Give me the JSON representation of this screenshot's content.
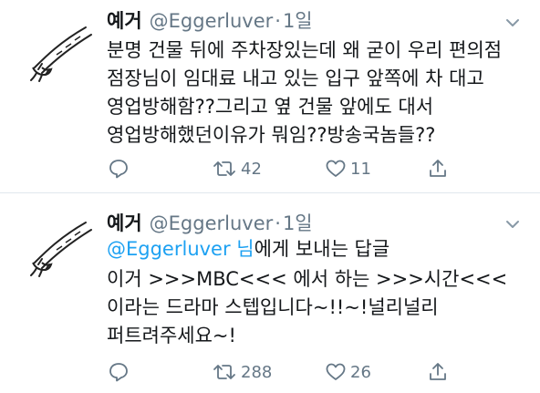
{
  "tweets": [
    {
      "name": "예거",
      "handle": "@Eggerluver",
      "separator": "·",
      "time": "1일",
      "reply_to": null,
      "lines": [
        "분명 건물 뒤에 주차장있는데 왜 굳이 우리 편의점",
        "점장님이 임대료 내고 있는 입구 앞쪽에 차 대고",
        "영업방해함??그리고 옆 건물 앞에도 대서",
        "영업방해했던이유가 뭐임??방송국놈들??"
      ],
      "retweets": "42",
      "likes": "11"
    },
    {
      "name": "예거",
      "handle": "@Eggerluver",
      "separator": "·",
      "time": "1일",
      "reply_to": {
        "mention": "@Eggerluver 님",
        "suffix": "에게 보내는 답글"
      },
      "lines": [
        "이거 >>>MBC<<< 에서 하는 >>>시간<<<",
        "이라는 드라마 스텝입니다~!!~!널리널리",
        "퍼트려주세요~!"
      ],
      "retweets": "288",
      "likes": "26"
    }
  ],
  "icons": {
    "avatar": "bird-sketch-icon",
    "menu": "chevron-down-icon",
    "reply": "reply-icon",
    "retweet": "retweet-icon",
    "like": "heart-icon",
    "share": "share-icon"
  },
  "colors": {
    "text": "#14171a",
    "secondary": "#657786",
    "link": "#1da1f2",
    "divider": "#e1e8ed"
  }
}
